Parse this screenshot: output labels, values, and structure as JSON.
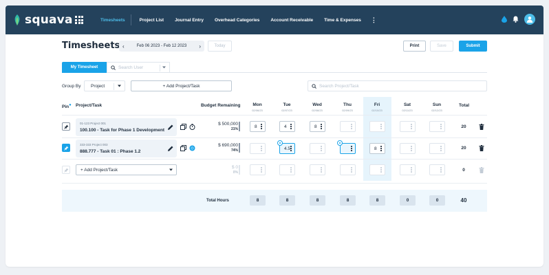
{
  "app": {
    "name": "squava"
  },
  "nav": {
    "items": [
      "Timesheets",
      "Project List",
      "Journal Entry",
      "Overhead Categories",
      "Account Receivable",
      "Time & Expenses"
    ],
    "active": "Timesheets"
  },
  "page": {
    "title": "Timesheets"
  },
  "date_range": "Feb 06 2023 - Feb 12 2023",
  "toolbar": {
    "today": "Today",
    "print": "Print",
    "save": "Save",
    "submit": "Submit"
  },
  "tabs": {
    "my_timesheet": "My Timesheet",
    "user_search_placeholder": "Search User"
  },
  "filters": {
    "group_by_label": "Group By",
    "group_by_value": "Project",
    "add_project": "+ Add Project/Task",
    "search_placeholder": "Search Project/Task"
  },
  "columns": {
    "pin": "Pin",
    "project": "Project/Task",
    "budget": "Budget Remaining",
    "total": "Total",
    "days": [
      {
        "name": "Mon",
        "date": "02/06/23"
      },
      {
        "name": "Tue",
        "date": "02/07/23"
      },
      {
        "name": "Wed",
        "date": "02/08/23"
      },
      {
        "name": "Thu",
        "date": "02/09/23"
      },
      {
        "name": "Fri",
        "date": "02/10/23"
      },
      {
        "name": "Sat",
        "date": "02/11/23"
      },
      {
        "name": "Sun",
        "date": "02/12/23"
      }
    ]
  },
  "rows": [
    {
      "code": "01-123 Project 001",
      "task": "100.100 - Task for Phase 1 Development",
      "budget": "$ 500,000",
      "budget_pct": "21%",
      "hours": [
        "8",
        "4",
        "8",
        "",
        "",
        "",
        ""
      ],
      "total": "20"
    },
    {
      "code": "333-333 Project 003",
      "task": "888.777 - Task 01 : Phase 1.2",
      "budget": "$ 690,000",
      "budget_pct": "74%",
      "hours": [
        "",
        "4.5",
        "",
        "",
        "8",
        "",
        ""
      ],
      "total": "20"
    }
  ],
  "new_row": {
    "add_label": "+ Add Project/Task",
    "budget": "$ 0",
    "budget_pct": "0%",
    "total": "0"
  },
  "totals": {
    "label": "Total Hours",
    "days": [
      "8",
      "8",
      "8",
      "8",
      "8",
      "0",
      "0"
    ],
    "grand": "40"
  }
}
